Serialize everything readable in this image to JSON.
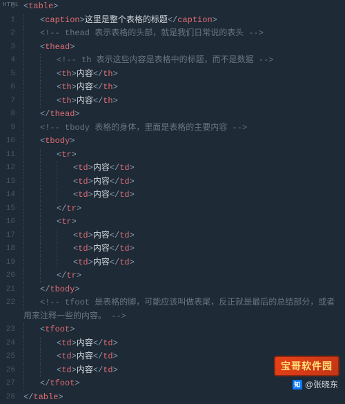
{
  "language_label": "HTML",
  "line_count": 29,
  "lines": [
    {
      "indent": 0,
      "type": "tag-open",
      "tag": "table"
    },
    {
      "indent": 1,
      "type": "tag-wrap",
      "tag": "caption",
      "text": "这里是整个表格的标题"
    },
    {
      "indent": 1,
      "type": "comment",
      "text": "<!-- thead 表示表格的头部，就是我们日常说的表头 -->"
    },
    {
      "indent": 1,
      "type": "tag-open",
      "tag": "thead"
    },
    {
      "indent": 2,
      "type": "comment",
      "text": "<!-- th 表示这些内容是表格中的标题，而不是数据 -->"
    },
    {
      "indent": 2,
      "type": "tag-wrap",
      "tag": "th",
      "text": "内容"
    },
    {
      "indent": 2,
      "type": "tag-wrap",
      "tag": "th",
      "text": "内容"
    },
    {
      "indent": 2,
      "type": "tag-wrap",
      "tag": "th",
      "text": "内容"
    },
    {
      "indent": 1,
      "type": "tag-close",
      "tag": "thead"
    },
    {
      "indent": 1,
      "type": "comment",
      "text": "<!-- tbody 表格的身体，里面是表格的主要内容 -->"
    },
    {
      "indent": 1,
      "type": "tag-open",
      "tag": "tbody"
    },
    {
      "indent": 2,
      "type": "tag-open",
      "tag": "tr"
    },
    {
      "indent": 3,
      "type": "tag-wrap",
      "tag": "td",
      "text": "内容"
    },
    {
      "indent": 3,
      "type": "tag-wrap",
      "tag": "td",
      "text": "内容"
    },
    {
      "indent": 3,
      "type": "tag-wrap",
      "tag": "td",
      "text": "内容"
    },
    {
      "indent": 2,
      "type": "tag-close",
      "tag": "tr"
    },
    {
      "indent": 2,
      "type": "tag-open",
      "tag": "tr"
    },
    {
      "indent": 3,
      "type": "tag-wrap",
      "tag": "td",
      "text": "内容"
    },
    {
      "indent": 3,
      "type": "tag-wrap",
      "tag": "td",
      "text": "内容"
    },
    {
      "indent": 3,
      "type": "tag-wrap",
      "tag": "td",
      "text": "内容"
    },
    {
      "indent": 2,
      "type": "tag-close",
      "tag": "tr"
    },
    {
      "indent": 1,
      "type": "tag-close",
      "tag": "tbody"
    },
    {
      "indent": 1,
      "type": "comment-multi",
      "text": "<!-- tfoot 是表格的脚，可能应该叫做表尾，反正就是最后的总结部分，或者用来注释一些的内容。 -->"
    },
    {
      "indent": 1,
      "type": "tag-open",
      "tag": "tfoot"
    },
    {
      "indent": 2,
      "type": "tag-wrap",
      "tag": "td",
      "text": "内容"
    },
    {
      "indent": 2,
      "type": "tag-wrap",
      "tag": "td",
      "text": "内容"
    },
    {
      "indent": 2,
      "type": "tag-wrap",
      "tag": "td",
      "text": "内容"
    },
    {
      "indent": 1,
      "type": "tag-close",
      "tag": "tfoot"
    },
    {
      "indent": 0,
      "type": "tag-close",
      "tag": "table"
    }
  ],
  "watermark1": "宝哥软件园",
  "watermark2_label": "知",
  "watermark2_text": "@张晓东"
}
